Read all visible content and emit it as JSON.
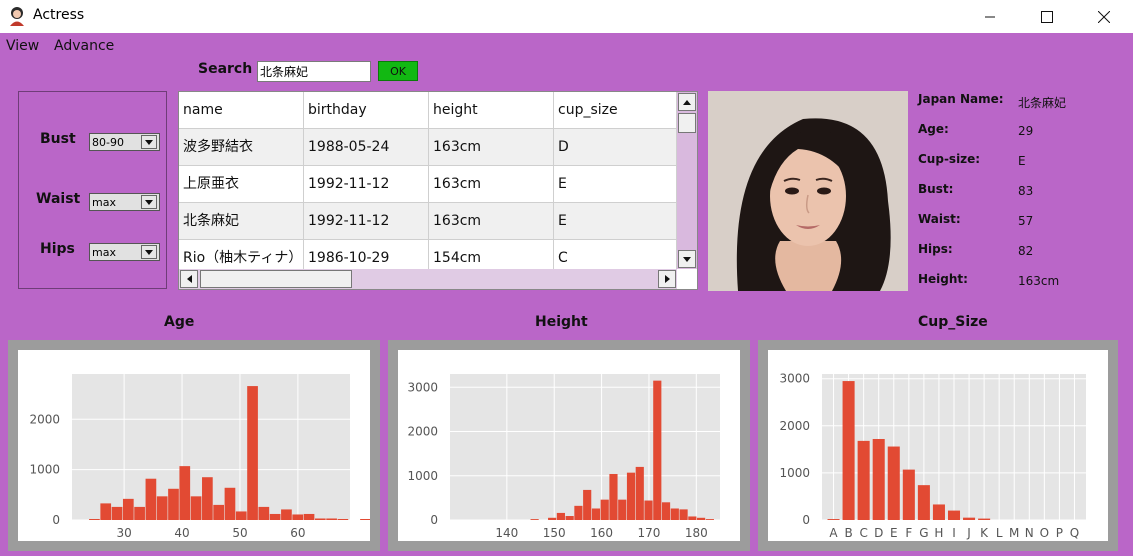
{
  "window": {
    "title": "Actress",
    "icon": "actress-avatar-icon",
    "controls": [
      "minimize-icon",
      "maximize-icon",
      "close-icon"
    ]
  },
  "menu": {
    "items": [
      "View",
      "Advance"
    ]
  },
  "search": {
    "label": "Search",
    "value": "北条麻妃",
    "button": "OK"
  },
  "filters": [
    {
      "label": "Bust",
      "value": "80-90"
    },
    {
      "label": "Waist",
      "value": "max"
    },
    {
      "label": "Hips",
      "value": "max"
    }
  ],
  "table": {
    "columns": [
      "name",
      "birthday",
      "height",
      "cup_size"
    ],
    "rows": [
      [
        "波多野結衣",
        "1988-05-24",
        "163cm",
        "D"
      ],
      [
        "上原亜衣",
        "1992-11-12",
        "163cm",
        "E"
      ],
      [
        "北条麻妃",
        "1992-11-12",
        "163cm",
        "E"
      ],
      [
        "Rio（柚木ティナ）",
        "1986-10-29",
        "154cm",
        "C"
      ]
    ]
  },
  "profile": {
    "fields": [
      {
        "label": "Japan Name:",
        "value": "北条麻妃"
      },
      {
        "label": "Age:",
        "value": "29"
      },
      {
        "label": "Cup-size:",
        "value": "E"
      },
      {
        "label": "Bust:",
        "value": "83"
      },
      {
        "label": "Waist:",
        "value": "57"
      },
      {
        "label": "Hips:",
        "value": "82"
      },
      {
        "label": "Height:",
        "value": "163cm"
      }
    ]
  },
  "charts": {
    "age_title": "Age",
    "height_title": "Height",
    "cup_title": "Cup_Size"
  },
  "chart_data": [
    {
      "type": "bar",
      "title": "Age",
      "xlim": [
        21,
        69
      ],
      "ylim": [
        0,
        2900
      ],
      "xticks": [
        30,
        40,
        50,
        60
      ],
      "yticks": [
        0,
        1000,
        2000
      ],
      "bin_start": 22,
      "bin_width": 1.95,
      "values": [
        0,
        20,
        330,
        260,
        420,
        260,
        820,
        470,
        620,
        1070,
        470,
        850,
        300,
        640,
        170,
        2660,
        260,
        120,
        210,
        110,
        120,
        30,
        30,
        20,
        0,
        20,
        0,
        0,
        0,
        0,
        0,
        0
      ]
    },
    {
      "type": "bar",
      "title": "Height",
      "xlim": [
        128,
        185
      ],
      "ylim": [
        0,
        3300
      ],
      "xticks": [
        140,
        150,
        160,
        170,
        180
      ],
      "yticks": [
        0,
        1000,
        2000,
        3000
      ],
      "bin_start": 145,
      "bin_width": 1.85,
      "values": [
        20,
        0,
        50,
        160,
        90,
        320,
        680,
        260,
        460,
        1040,
        460,
        1070,
        1200,
        440,
        3150,
        400,
        260,
        240,
        80,
        50,
        20,
        0,
        0
      ]
    },
    {
      "type": "bar",
      "title": "Cup_Size",
      "ylim": [
        0,
        3100
      ],
      "categories": [
        "A",
        "B",
        "C",
        "D",
        "E",
        "F",
        "G",
        "H",
        "I",
        "J",
        "K",
        "L",
        "M",
        "N",
        "O",
        "P",
        "Q"
      ],
      "yticks": [
        0,
        1000,
        2000,
        3000
      ],
      "values": [
        20,
        2950,
        1680,
        1720,
        1560,
        1070,
        740,
        330,
        200,
        50,
        30,
        0,
        0,
        0,
        0,
        0,
        0
      ]
    }
  ],
  "colors": {
    "background": "#ba66c8",
    "bar": "#e24a33",
    "plot_bg": "#e5e5e5",
    "ok_button": "#12b812"
  }
}
